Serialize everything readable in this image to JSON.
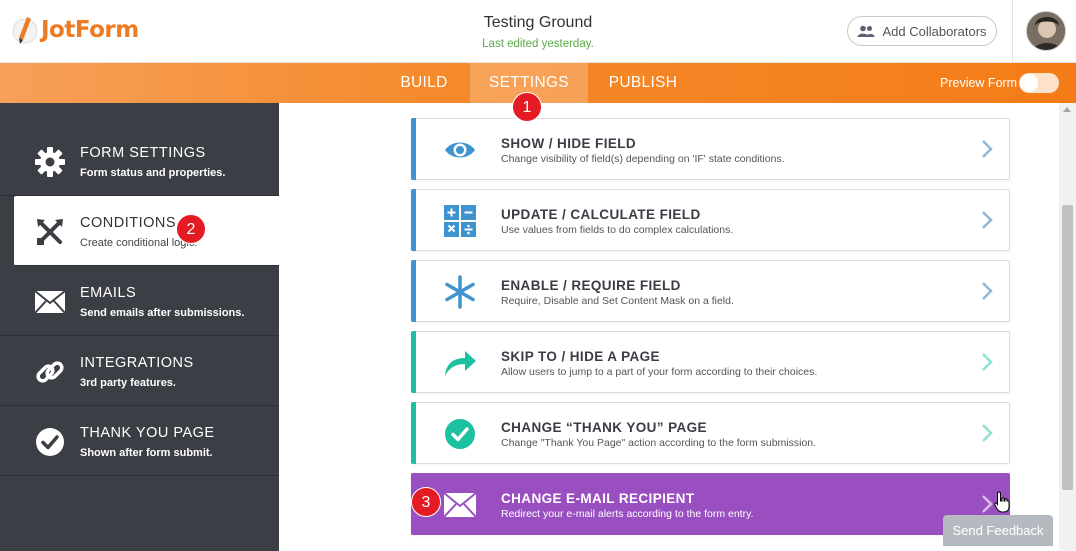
{
  "app": {
    "logo_text": "JotForm"
  },
  "header": {
    "form_title": "Testing Ground",
    "form_status": "Last edited yesterday.",
    "collab_label": "Add Collaborators"
  },
  "nav": {
    "tabs": [
      {
        "label": "BUILD",
        "active": false
      },
      {
        "label": "SETTINGS",
        "active": true
      },
      {
        "label": "PUBLISH",
        "active": false
      }
    ],
    "preview_label": "Preview Form",
    "preview_on": false
  },
  "sidebar": {
    "items": [
      {
        "title": "FORM SETTINGS",
        "desc": "Form status and properties.",
        "icon": "gear-icon",
        "active": false
      },
      {
        "title": "CONDITIONS",
        "desc": "Create conditional logic.",
        "icon": "conditions-icon",
        "active": true
      },
      {
        "title": "EMAILS",
        "desc": "Send emails after submissions.",
        "icon": "envelope-icon",
        "active": false
      },
      {
        "title": "INTEGRATIONS",
        "desc": "3rd party features.",
        "icon": "link-icon",
        "active": false
      },
      {
        "title": "THANK YOU PAGE",
        "desc": "Shown after form submit.",
        "icon": "check-circle-icon",
        "active": false
      }
    ]
  },
  "conditions": [
    {
      "title": "SHOW / HIDE FIELD",
      "desc": "Change visibility of field(s) depending on 'IF' state conditions.",
      "icon": "eye-icon",
      "accent": "#3f93cf"
    },
    {
      "title": "UPDATE / CALCULATE FIELD",
      "desc": "Use values from fields to do complex calculations.",
      "icon": "calculator-icon",
      "accent": "#3f93cf"
    },
    {
      "title": "ENABLE / REQUIRE FIELD",
      "desc": "Require, Disable and Set Content Mask on a field.",
      "icon": "asterisk-icon",
      "accent": "#3f93cf"
    },
    {
      "title": "SKIP TO / HIDE A PAGE",
      "desc": "Allow users to jump to a part of your form according to their choices.",
      "icon": "skip-arrow-icon",
      "accent": "#1bc1a1"
    },
    {
      "title": "CHANGE “THANK YOU” PAGE",
      "desc": "Change \"Thank You Page\" action according to the form submission.",
      "icon": "check-circle-icon",
      "accent": "#1bc1a1"
    },
    {
      "title": "CHANGE E-MAIL RECIPIENT",
      "desc": "Redirect your e-mail alerts according to the form entry.",
      "icon": "envelope-icon",
      "accent": "#9a4fc1",
      "highlighted": true
    }
  ],
  "annotations": [
    "1",
    "2",
    "3"
  ],
  "feedback_label": "Send Feedback",
  "colors": {
    "brand_orange": "#f47c18",
    "sidebar_bg": "#3b3e45",
    "blue_accent": "#3f93cf",
    "teal_accent": "#1bc1a1",
    "purple_accent": "#9a4fc1",
    "badge_red": "#e41b23"
  }
}
